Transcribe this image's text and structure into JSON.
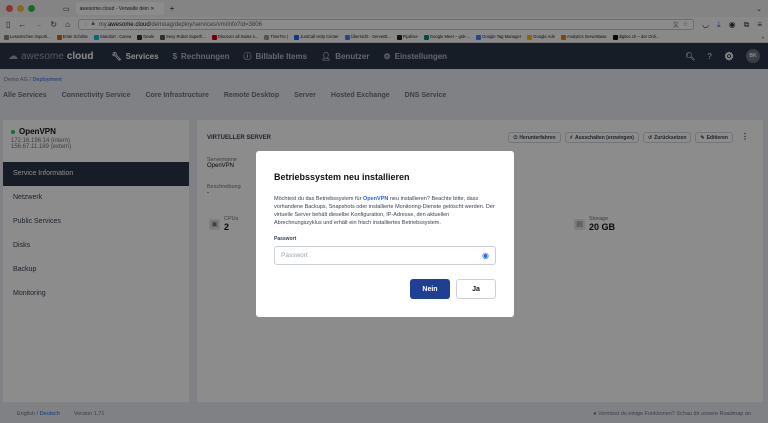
{
  "browser": {
    "tab_title": "awesome.cloud - Verwalte dein ✕",
    "url_prefix": "my.",
    "url_domain": "awesome.cloud",
    "url_path": "/demoag/deploy/services/vm/info?id=3806",
    "bookmarks": [
      "Lesezeichen importi...",
      "Erste Schritte",
      "Standort : Canva",
      "Deals",
      "Sexy Robot Superh...",
      "Discover all Swiss s...",
      "TimeTec |",
      "JustCall Help Center",
      "Übersicht - ServerB...",
      "Pipdrive",
      "Google Meet – gsb-...",
      "Google Tag Manager",
      "Google Ads",
      "Analytics ServerBase",
      "digitec.ch – der Onli..."
    ]
  },
  "app": {
    "logo_light": "awesome",
    "logo_bold": "cloud",
    "nav": [
      "Services",
      "Rechnungen",
      "Billable Items",
      "Benutzer",
      "Einstellungen"
    ],
    "avatar": "BK",
    "breadcrumb_root": "Demo AG",
    "breadcrumb_sep": "/",
    "breadcrumb_current": "Deployment",
    "subtabs": [
      "Alle Services",
      "Connectivity Service",
      "Core Infrastructure",
      "Remote Desktop",
      "Server",
      "Hosted Exchange",
      "DNS Service"
    ]
  },
  "sidebar": {
    "server_name": "OpenVPN",
    "ip_internal": "172.16.196.14 (intern)",
    "ip_external": "156.67.11.189 (extern)",
    "items": [
      "Service Information",
      "Netzwerk",
      "Public Services",
      "Disks",
      "Backup",
      "Monitoring"
    ]
  },
  "card": {
    "heading": "VIRTUELLER SERVER",
    "actions": [
      "Herunterfahren",
      "Ausschalten (erzwingen)",
      "Zurücksetzen",
      "Editieren"
    ],
    "servername_label": "Servername",
    "servername_value": "OpenVPN",
    "description_label": "Beschreibung",
    "description_value": "-",
    "cpu_label": "CPUs",
    "cpu_value": "2",
    "storage_label": "Storage",
    "storage_value": "20 GB"
  },
  "footer": {
    "lang_en": "English",
    "lang_sep": "/",
    "lang_de": "Deutsch",
    "version": "Version 1.71",
    "roadmap": "Vermisst du einige Funktionen? Schau dir unsere Roadmap an"
  },
  "modal": {
    "title": "Betriebssystem neu installieren",
    "text_before": "Möchtest du das Betriebssystem für ",
    "text_link": "OpenVPN",
    "text_after": " neu installieren? Beachte bitte, dass vorhandene Backups, Snapshots oder installierte Monitoring-Dienste gelöscht werden. Der virtuelle Server behält dieselbe Konfiguration, IP-Adresse, den aktuellen Abrechnungszyklus und erhält ein frisch installiertes Betriebssystem.",
    "password_label": "Passwort",
    "password_placeholder": "Passwort",
    "btn_no": "Nein",
    "btn_yes": "Ja"
  },
  "colors": {
    "header": "#2b3545",
    "primary": "#1d3f94",
    "link": "#2563eb"
  }
}
